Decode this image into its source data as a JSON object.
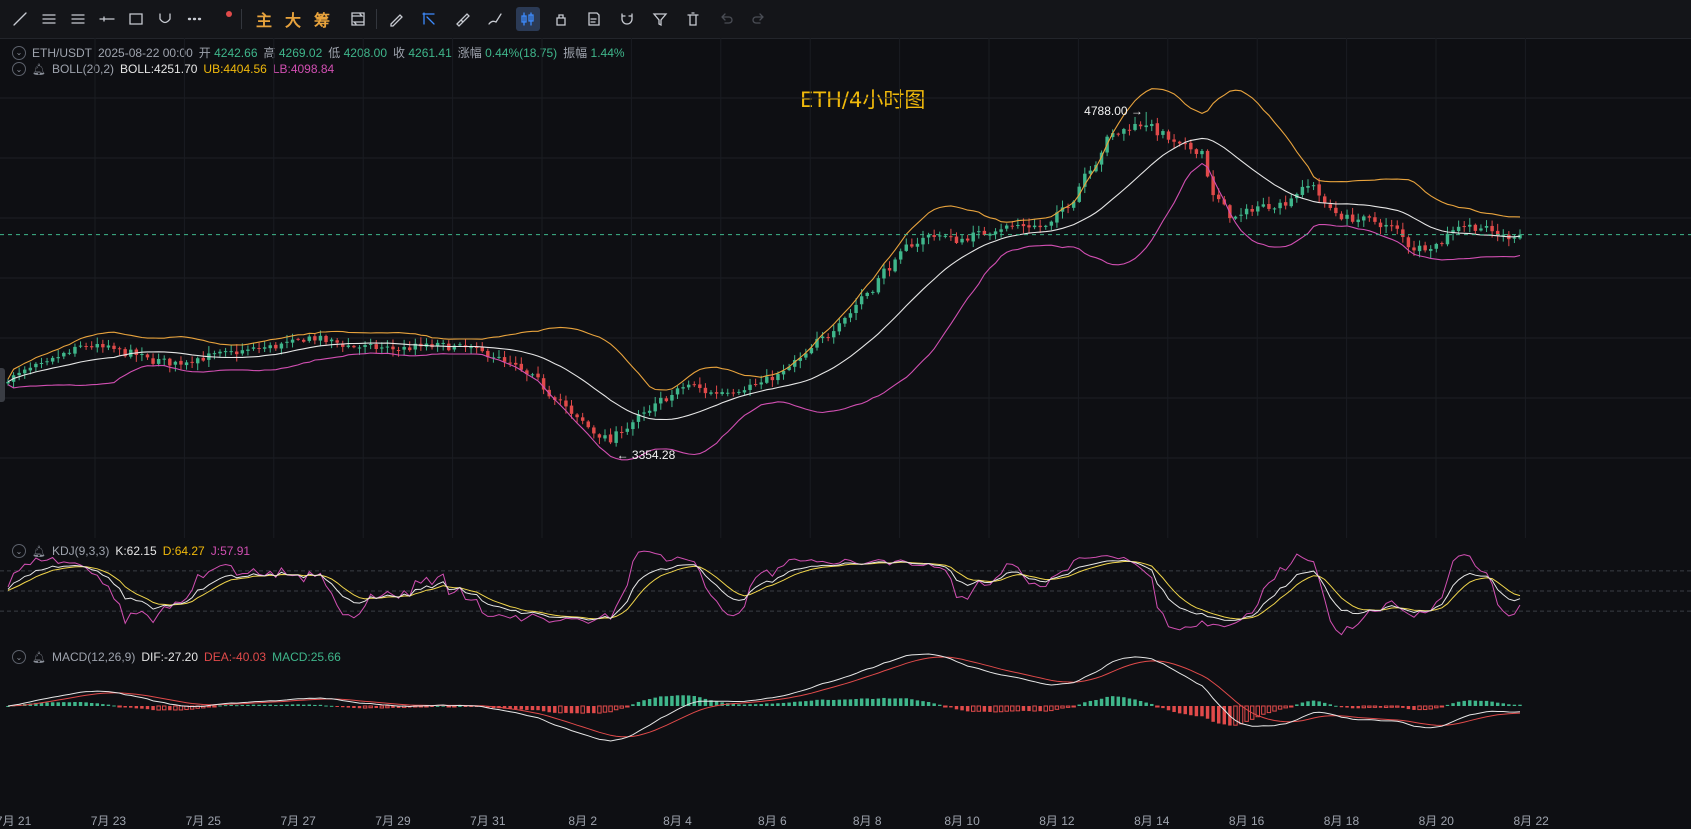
{
  "toolbar": {
    "tools": [
      {
        "icon": "trend-line-icon"
      },
      {
        "icon": "horizontal-lines-icon"
      },
      {
        "icon": "parallel-channel-icon"
      },
      {
        "icon": "horizontal-ray-icon"
      },
      {
        "icon": "rectangle-icon"
      },
      {
        "icon": "curve-icon"
      },
      {
        "icon": "more-tools-icon"
      }
    ],
    "text_buttons": [
      "主",
      "大",
      "筹"
    ],
    "right_tools": [
      {
        "icon": "sync-icon"
      },
      {
        "icon": "pen-edit-icon"
      },
      {
        "icon": "select-cursor-icon",
        "active": true
      },
      {
        "icon": "ruler-icon"
      },
      {
        "icon": "brush-icon"
      },
      {
        "icon": "candlestick-icon",
        "active": true
      },
      {
        "icon": "lock-icon"
      },
      {
        "icon": "note-icon"
      },
      {
        "icon": "magnet-icon"
      },
      {
        "icon": "filter-icon"
      },
      {
        "icon": "trash-icon"
      },
      {
        "icon": "undo-icon"
      },
      {
        "icon": "redo-icon"
      }
    ]
  },
  "header": {
    "pair": "ETH/USDT",
    "datetime": "2025-08-22 00:00",
    "open_label": "开",
    "open": "4242.66",
    "high_label": "高",
    "high": "4269.02",
    "low_label": "低",
    "low": "4208.00",
    "close_label": "收",
    "close": "4261.41",
    "change_label": "涨幅",
    "change": "0.44%(18.75)",
    "amp_label": "振幅",
    "amp": "1.44%"
  },
  "boll_legend": {
    "name": "BOLL(20,2)",
    "boll": "BOLL:4251.70",
    "ub": "UB:4404.56",
    "lb": "LB:4098.84"
  },
  "kdj_legend": {
    "name": "KDJ(9,3,3)",
    "k": "K:62.15",
    "d": "D:64.27",
    "j": "J:57.91"
  },
  "macd_legend": {
    "name": "MACD(12,26,9)",
    "dif": "DIF:-27.20",
    "dea": "DEA:-40.03",
    "macd": "MACD:25.66"
  },
  "title": "ETH/4小时图",
  "high_marker": "4788.00",
  "low_marker": "3354.28",
  "colors": {
    "up": "#3fb68b",
    "down": "#e04a4a",
    "mid": "#e6e6e6",
    "ub": "#e8a33d",
    "lb": "#d14fb2",
    "k": "#e6e6e6",
    "d": "#f0d54b",
    "j": "#d14fb2",
    "dif": "#e6e6e6",
    "dea": "#e04a4a"
  },
  "chart_data": {
    "type": "candlestick",
    "title": "ETH/4小时图",
    "x_ticks": [
      "7月 21",
      "7月 23",
      "7月 25",
      "7月 27",
      "7月 29",
      "7月 31",
      "8月 2",
      "8月 4",
      "8月 6",
      "8月 8",
      "8月 10",
      "8月 12",
      "8月 14",
      "8月 16",
      "8月 18",
      "8月 20",
      "8月 22"
    ],
    "anchors": [
      [
        0,
        3640
      ],
      [
        6,
        3690
      ],
      [
        10,
        3740
      ],
      [
        14,
        3780
      ],
      [
        18,
        3765
      ],
      [
        22,
        3745
      ],
      [
        26,
        3715
      ],
      [
        30,
        3705
      ],
      [
        34,
        3725
      ],
      [
        38,
        3740
      ],
      [
        42,
        3755
      ],
      [
        46,
        3770
      ],
      [
        50,
        3785
      ],
      [
        54,
        3815
      ],
      [
        58,
        3795
      ],
      [
        62,
        3775
      ],
      [
        66,
        3770
      ],
      [
        70,
        3765
      ],
      [
        74,
        3775
      ],
      [
        78,
        3778
      ],
      [
        82,
        3768
      ],
      [
        86,
        3745
      ],
      [
        90,
        3695
      ],
      [
        94,
        3640
      ],
      [
        98,
        3560
      ],
      [
        102,
        3460
      ],
      [
        106,
        3395
      ],
      [
        108,
        3365
      ],
      [
        110,
        3420
      ],
      [
        114,
        3480
      ],
      [
        118,
        3555
      ],
      [
        122,
        3610
      ],
      [
        126,
        3575
      ],
      [
        130,
        3590
      ],
      [
        134,
        3610
      ],
      [
        138,
        3650
      ],
      [
        142,
        3720
      ],
      [
        146,
        3810
      ],
      [
        150,
        3905
      ],
      [
        154,
        4010
      ],
      [
        158,
        4120
      ],
      [
        162,
        4220
      ],
      [
        166,
        4260
      ],
      [
        170,
        4235
      ],
      [
        174,
        4260
      ],
      [
        178,
        4290
      ],
      [
        182,
        4300
      ],
      [
        186,
        4290
      ],
      [
        190,
        4390
      ],
      [
        194,
        4550
      ],
      [
        198,
        4690
      ],
      [
        202,
        4730
      ],
      [
        204,
        4740
      ],
      [
        206,
        4700
      ],
      [
        210,
        4640
      ],
      [
        214,
        4620
      ],
      [
        216,
        4420
      ],
      [
        220,
        4330
      ],
      [
        224,
        4380
      ],
      [
        228,
        4390
      ],
      [
        232,
        4450
      ],
      [
        234,
        4480
      ],
      [
        236,
        4380
      ],
      [
        240,
        4330
      ],
      [
        244,
        4320
      ],
      [
        248,
        4290
      ],
      [
        252,
        4200
      ],
      [
        256,
        4215
      ],
      [
        260,
        4300
      ],
      [
        264,
        4290
      ],
      [
        266,
        4270
      ],
      [
        268,
        4250
      ],
      [
        271,
        4260
      ]
    ],
    "series": [
      {
        "name": "BOLL",
        "last": 4251.7
      },
      {
        "name": "UB",
        "last": 4404.56
      },
      {
        "name": "LB",
        "last": 4098.84
      }
    ],
    "ylim": [
      3100,
      4900
    ],
    "bar_count": 272
  }
}
